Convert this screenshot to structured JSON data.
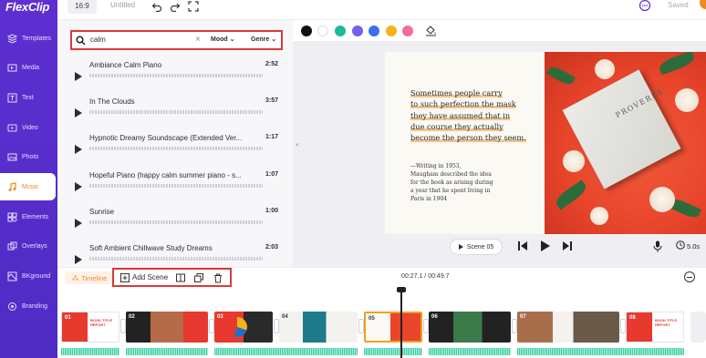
{
  "app": {
    "logo": "FlexClip"
  },
  "topbar": {
    "ratio": "16:9",
    "title": "Untitled",
    "saved": "Saved"
  },
  "sidebar": {
    "items": [
      {
        "label": "Templates",
        "icon": "templates-icon"
      },
      {
        "label": "Media",
        "icon": "media-icon"
      },
      {
        "label": "Text",
        "icon": "text-icon"
      },
      {
        "label": "Video",
        "icon": "video-icon"
      },
      {
        "label": "Photo",
        "icon": "photo-icon"
      },
      {
        "label": "Music",
        "icon": "music-icon",
        "active": true
      },
      {
        "label": "Elements",
        "icon": "elements-icon"
      },
      {
        "label": "Overlays",
        "icon": "overlays-icon"
      },
      {
        "label": "BKground",
        "icon": "background-icon"
      },
      {
        "label": "Branding",
        "icon": "branding-icon"
      }
    ]
  },
  "search": {
    "value": "calm",
    "mood_label": "Mood",
    "genre_label": "Genre"
  },
  "tracks": [
    {
      "name": "Ambiance Calm Piano",
      "duration": "2:52"
    },
    {
      "name": "In The Clouds",
      "duration": "3:57"
    },
    {
      "name": "Hypnotic Dreamy Soundscape (Extended Ver...",
      "duration": "1:17"
    },
    {
      "name": "Hopeful Piano (happy calm summer piano - s...",
      "duration": "1:07"
    },
    {
      "name": "Sunrise",
      "duration": "1:00"
    },
    {
      "name": "Soft Ambient Chillwave Study Dreams",
      "duration": "2:03"
    }
  ],
  "colors": {
    "swatches": [
      "#111111",
      "#ffffff",
      "#1fb89a",
      "#7b5cf0",
      "#3a6ff0",
      "#f5b21b",
      "#f36c9a"
    ],
    "accent": "#f08a24",
    "sidebar": "#5a2ecf",
    "highlight_box": "#d93a3a"
  },
  "slide": {
    "quote_lines": [
      "Sometimes people carry",
      "to  such perfection the mask",
      "they have assumed that in",
      "due course they actually",
      "become the person they seem."
    ],
    "note": "—Writing in 1953,\nMaugham described the idea\nfor the book as arising during\na year that he spent living in\nParis in 1904",
    "book_title": "PROVERBS"
  },
  "player": {
    "scene_label": "Scene 05",
    "duration": "5.0s"
  },
  "timeline": {
    "toggle_label": "Timeline",
    "add_scene_label": "Add Scene",
    "time_readout": "00:27.1 / 00:49.7",
    "clips": [
      {
        "num": "01",
        "caption": "BOOK TITLE REPORT"
      },
      {
        "num": "02",
        "caption": ""
      },
      {
        "num": "03",
        "caption": ""
      },
      {
        "num": "04",
        "caption": ""
      },
      {
        "num": "05",
        "caption": ""
      },
      {
        "num": "06",
        "caption": ""
      },
      {
        "num": "07",
        "caption": ""
      },
      {
        "num": "08",
        "caption": "BOOK TITLE REPORT"
      }
    ]
  }
}
